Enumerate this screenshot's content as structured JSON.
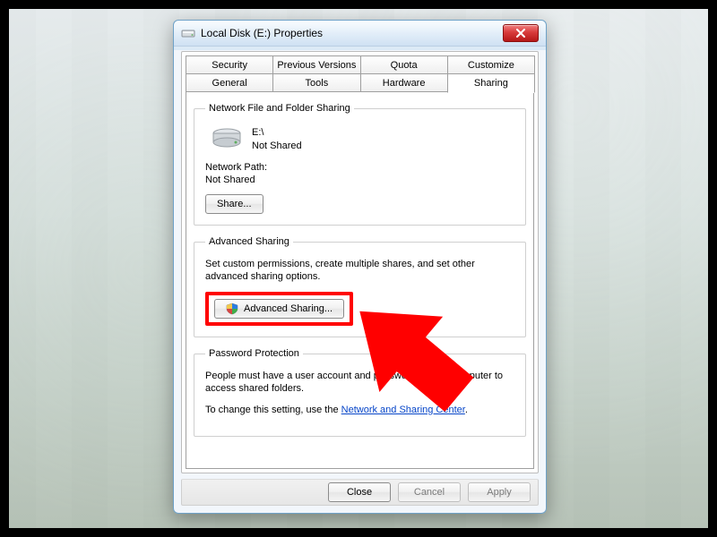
{
  "window": {
    "title": "Local Disk (E:) Properties"
  },
  "tabs": {
    "row1": [
      "Security",
      "Previous Versions",
      "Quota",
      "Customize"
    ],
    "row2": [
      "General",
      "Tools",
      "Hardware",
      "Sharing"
    ],
    "active": "Sharing"
  },
  "nfs": {
    "legend": "Network File and Folder Sharing",
    "drive_label": "E:\\",
    "share_status": "Not Shared",
    "network_path_label": "Network Path:",
    "network_path_value": "Not Shared",
    "share_button": "Share..."
  },
  "adv": {
    "legend": "Advanced Sharing",
    "desc": "Set custom permissions, create multiple shares, and set other advanced sharing options.",
    "button": "Advanced Sharing..."
  },
  "pp": {
    "legend": "Password Protection",
    "desc": "People must have a user account and password for this computer to access shared folders.",
    "hint_prefix": "To change this setting, use the ",
    "hint_link": "Network and Sharing Center",
    "hint_suffix": "."
  },
  "footer": {
    "close": "Close",
    "cancel": "Cancel",
    "apply": "Apply"
  }
}
